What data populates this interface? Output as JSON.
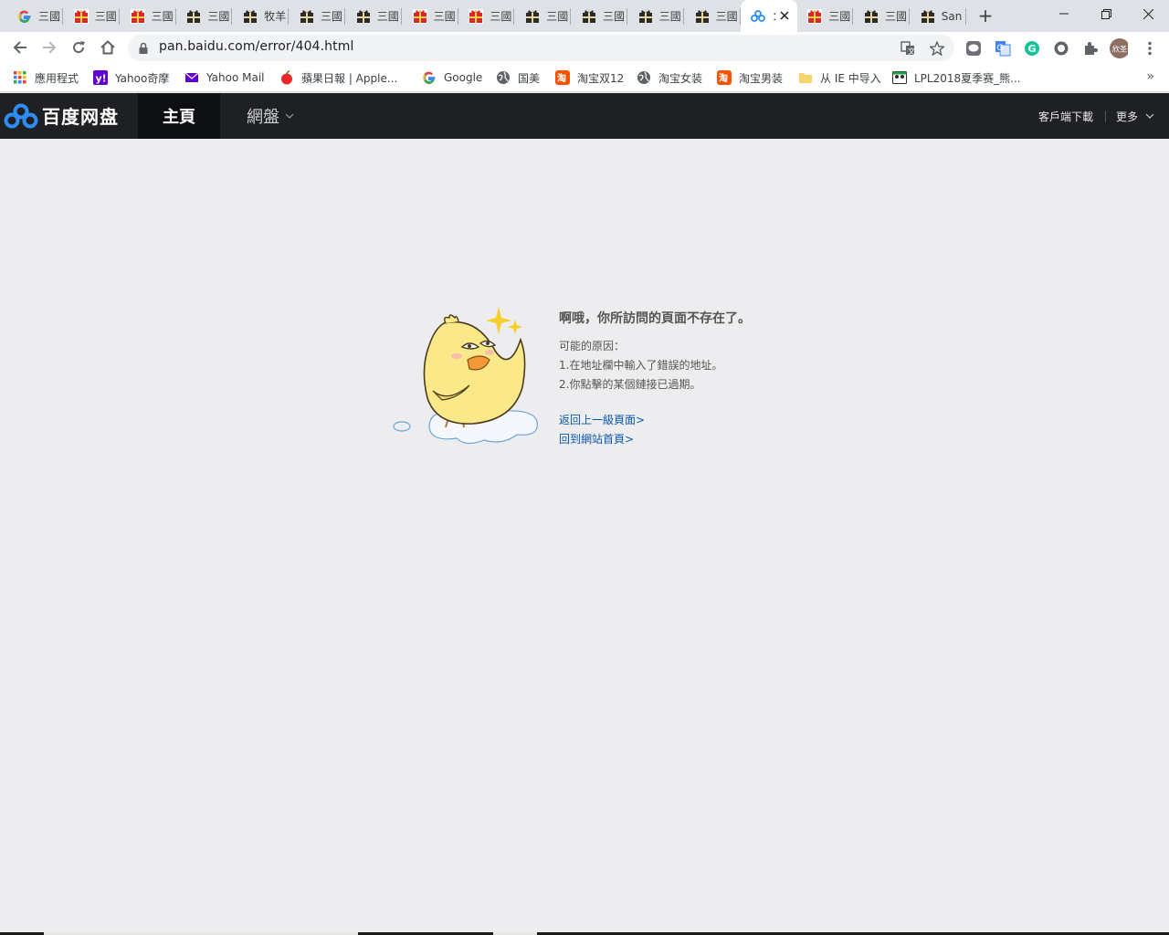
{
  "browser": {
    "tabs": [
      {
        "title": "三國",
        "icon": "google-g-icon"
      },
      {
        "title": "三國",
        "icon": "red-gift-icon"
      },
      {
        "title": "三國",
        "icon": "red-gift-icon"
      },
      {
        "title": "三國",
        "icon": "black-gift-icon"
      },
      {
        "title": "牧羊",
        "icon": "black-gift-icon"
      },
      {
        "title": "三國",
        "icon": "black-gift-icon"
      },
      {
        "title": "三國",
        "icon": "black-gift-icon"
      },
      {
        "title": "三國",
        "icon": "red-gift-icon"
      },
      {
        "title": "三國",
        "icon": "red-gift-icon"
      },
      {
        "title": "三國",
        "icon": "black-gift-icon"
      },
      {
        "title": "三國",
        "icon": "black-gift-icon"
      },
      {
        "title": "三國",
        "icon": "black-gift-icon"
      },
      {
        "title": "三國",
        "icon": "black-gift-icon"
      },
      {
        "title": "：",
        "icon": "baidu-cloud-icon",
        "active": true
      },
      {
        "title": "三國",
        "icon": "red-gift-icon"
      },
      {
        "title": "三國",
        "icon": "black-gift-icon"
      },
      {
        "title": "San",
        "icon": "black-gift-icon"
      }
    ],
    "new_tab": "+",
    "url": "pan.baidu.com/error/404.html",
    "bookmarks": [
      {
        "label": "應用程式",
        "icon": "apps-grid-icon"
      },
      {
        "label": "Yahoo奇摩",
        "icon": "yahoo-icon"
      },
      {
        "label": "Yahoo Mail",
        "icon": "mail-icon"
      },
      {
        "label": "蘋果日報 | Apple...",
        "icon": "apple-daily-icon"
      },
      {
        "label": "Google",
        "icon": "google-g-icon"
      },
      {
        "label": "国美",
        "icon": "globe-icon"
      },
      {
        "label": "淘宝双12",
        "icon": "taobao-icon"
      },
      {
        "label": "淘宝女装",
        "icon": "globe-icon"
      },
      {
        "label": "淘宝男装",
        "icon": "taobao-icon"
      },
      {
        "label": "从 IE 中导入",
        "icon": "folder-icon"
      },
      {
        "label": "LPL2018夏季赛_熊...",
        "icon": "panda-icon"
      }
    ],
    "bookmarks_more": "»",
    "profile_initials": "欣圣"
  },
  "site": {
    "logo_text": "百度网盘",
    "nav_home": "主頁",
    "nav_pan": "網盤",
    "client_download": "客戶端下載",
    "more": "更多"
  },
  "error": {
    "title": "啊哦，你所訪問的頁面不存在了。",
    "reasons_label": "可能的原因：",
    "reason_1": "1.在地址欄中輸入了錯誤的地址。",
    "reason_2": "2.你點擊的某個鏈接已過期。",
    "link_back": "返回上一級頁面>",
    "link_home": "回到網站首頁>"
  },
  "colors": {
    "header_bg": "#1f2024",
    "active_nav_bg": "#0e0f12",
    "page_bg": "#ededef",
    "link": "#0a58aa"
  }
}
